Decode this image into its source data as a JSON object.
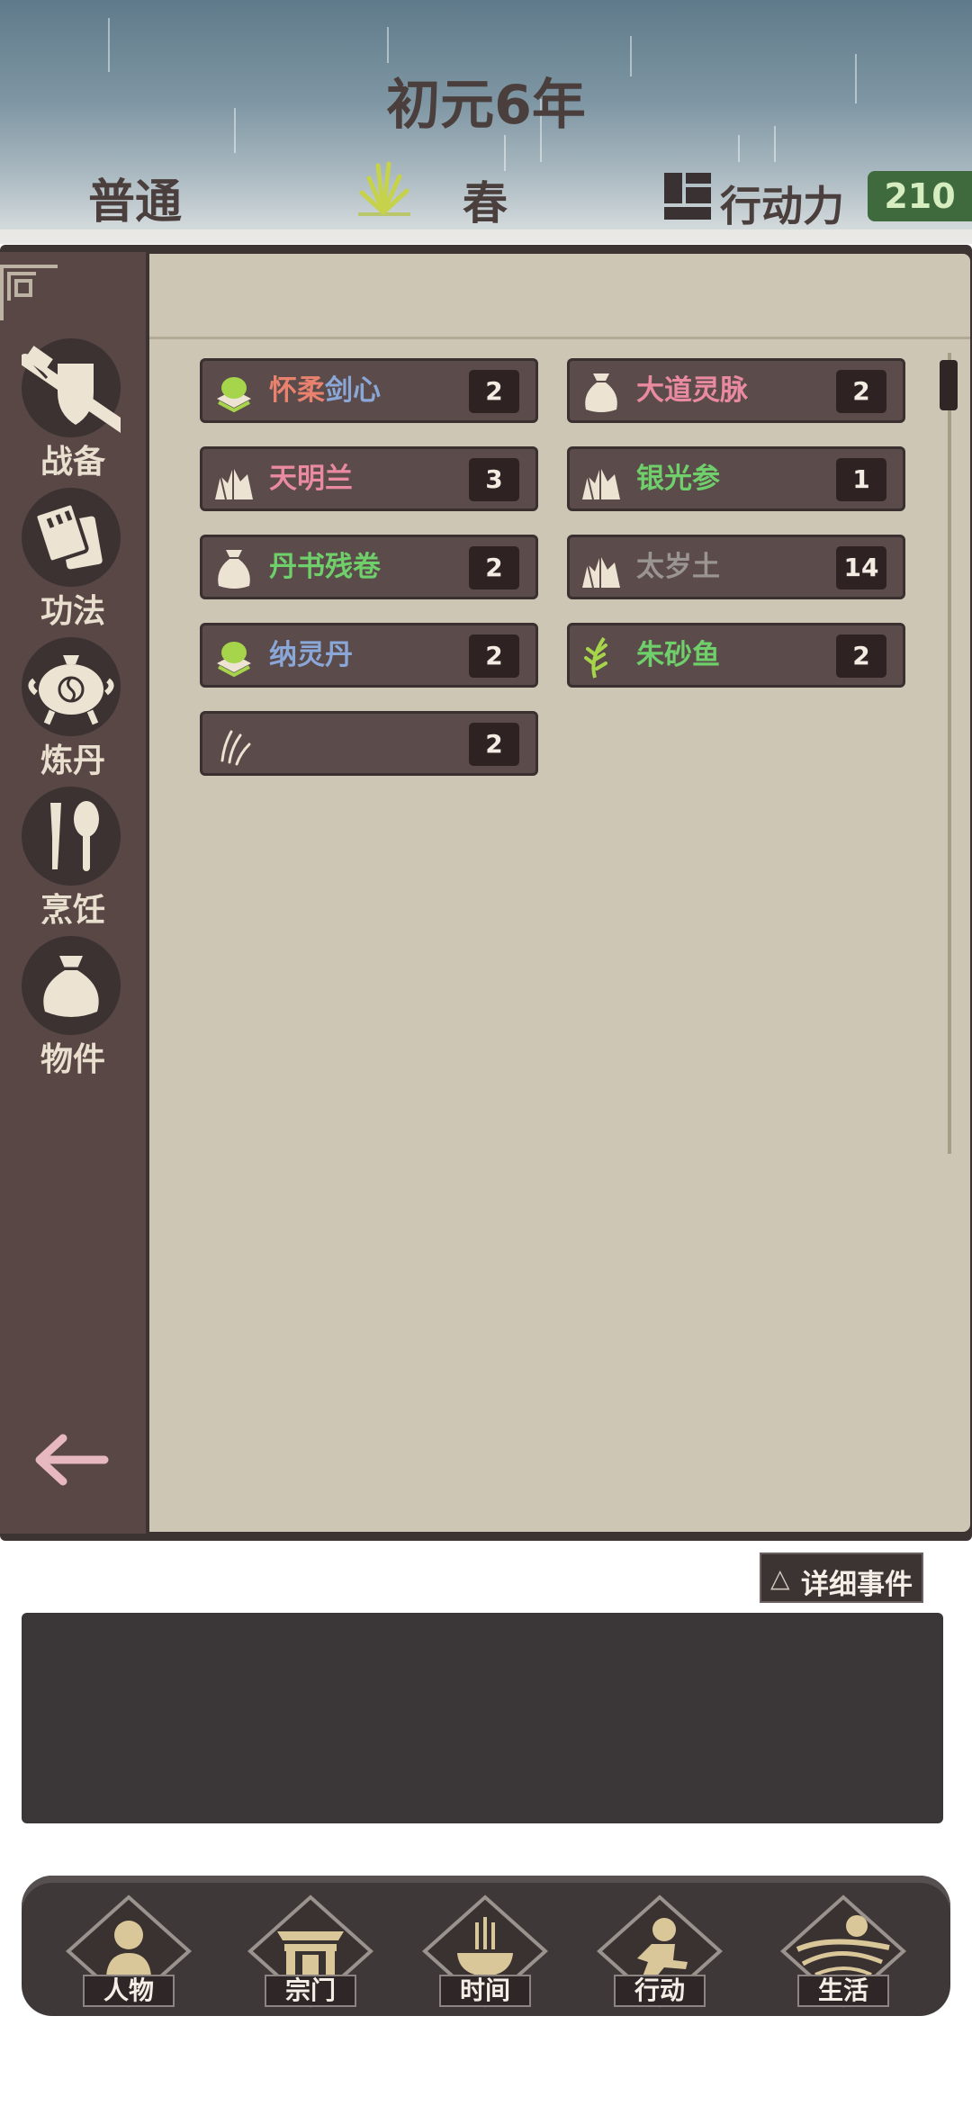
{
  "header": {
    "year": "初元6年",
    "difficulty": "普通",
    "season": "春",
    "action_points_label": "行动力",
    "action_points_value": "210"
  },
  "sidebar": {
    "items": [
      {
        "label": "战备",
        "icon": "sword-shield-icon"
      },
      {
        "label": "功法",
        "icon": "scroll-book-icon"
      },
      {
        "label": "炼丹",
        "icon": "alchemy-furnace-icon"
      },
      {
        "label": "烹饪",
        "icon": "cooking-utensils-icon"
      },
      {
        "label": "物件",
        "icon": "pouch-icon"
      }
    ],
    "back_icon": "back-arrow-icon"
  },
  "inventory": {
    "items": [
      {
        "name_parts": [
          "怀柔",
          "剑心"
        ],
        "name_colors": [
          "#e8826e",
          "#8aa7d8"
        ],
        "count": "2",
        "icon": "jade-pedestal-icon"
      },
      {
        "name_parts": [
          "大道灵脉"
        ],
        "name_colors": [
          "#e98aa0"
        ],
        "count": "2",
        "icon": "pouch-icon"
      },
      {
        "name_parts": [
          "天明兰"
        ],
        "name_colors": [
          "#e98aa0"
        ],
        "count": "3",
        "icon": "ore-crystal-icon"
      },
      {
        "name_parts": [
          "银光参"
        ],
        "name_colors": [
          "#6fcf6a"
        ],
        "count": "1",
        "icon": "ore-crystal-icon"
      },
      {
        "name_parts": [
          "丹书残卷"
        ],
        "name_colors": [
          "#6fcf6a"
        ],
        "count": "2",
        "icon": "pouch-icon"
      },
      {
        "name_parts": [
          "太岁土"
        ],
        "name_colors": [
          "#9a9492"
        ],
        "count": "14",
        "icon": "ore-crystal-icon"
      },
      {
        "name_parts": [
          "纳灵丹"
        ],
        "name_colors": [
          "#8aa7d8"
        ],
        "count": "2",
        "icon": "jade-pedestal-icon"
      },
      {
        "name_parts": [
          "朱砂鱼"
        ],
        "name_colors": [
          "#6fcf6a"
        ],
        "count": "2",
        "icon": "herb-sprig-icon"
      },
      {
        "name_parts": [
          ""
        ],
        "name_colors": [
          "#e8dfce"
        ],
        "count": "2",
        "icon": "claw-scratch-icon"
      }
    ]
  },
  "events": {
    "detail_button_label": "详细事件",
    "detail_button_icon": "triangle-up-icon"
  },
  "bottom_nav": {
    "items": [
      {
        "label": "人物",
        "icon": "person-icon"
      },
      {
        "label": "宗门",
        "icon": "sect-gate-icon"
      },
      {
        "label": "时间",
        "icon": "incense-burner-icon"
      },
      {
        "label": "行动",
        "icon": "action-figure-icon"
      },
      {
        "label": "生活",
        "icon": "landscape-icon"
      }
    ]
  },
  "colors": {
    "sidebar_bg": "#594746",
    "content_bg": "#cdc6b4",
    "item_bg": "#5b4b4b",
    "action_points_bg": "#3e6a3e"
  }
}
